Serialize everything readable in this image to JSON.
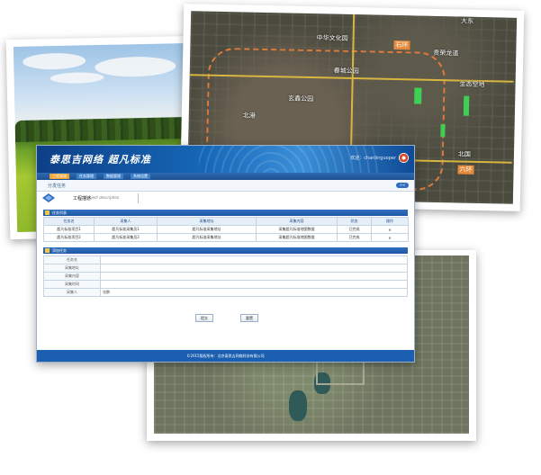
{
  "map_top": {
    "labels": [
      "中华文化园",
      "石环",
      "春城公园",
      "贵荣龙道",
      "生态空地",
      "玄鑫公园",
      "北国",
      "北港",
      "大东"
    ],
    "badges": [
      "石环",
      "六环"
    ]
  },
  "window": {
    "brand": "泰思吉网络 超凡标准",
    "user": "欢迎：chanlinguoper",
    "nav": [
      "工程管理",
      "任务管理",
      "数据管理",
      "系统设置"
    ],
    "breadcrumb": "分发任务",
    "back": "<<",
    "project_title": "工程描述",
    "project_sub": "Project description",
    "task_section": "任务列表",
    "task_headers": [
      "任务名",
      "采集人",
      "采集地址",
      "采集内容",
      "状态",
      "操作"
    ],
    "task_rows": [
      {
        "name": "超凡标准项目1",
        "collector": "超凡标准采集员1",
        "address": "超凡标准采集地址",
        "content": "采集超凡标准地图数据",
        "status": "已完成",
        "op": "✕"
      },
      {
        "name": "超凡标准项目2",
        "collector": "超凡标准采集员2",
        "address": "超凡标准采集地址",
        "content": "采集超凡标准地图数据",
        "status": "已完成",
        "op": "✕"
      }
    ],
    "add_section": "添加任务",
    "form_labels": [
      "任务名",
      "采集地址",
      "采集内容",
      "采集时间",
      "采集人"
    ],
    "form_values": [
      "",
      "",
      "",
      "",
      "张鹏"
    ],
    "buttons": [
      "提交",
      "重置"
    ],
    "footer": "©2015版权所有：北京泰思吉网络科技有限公司"
  }
}
